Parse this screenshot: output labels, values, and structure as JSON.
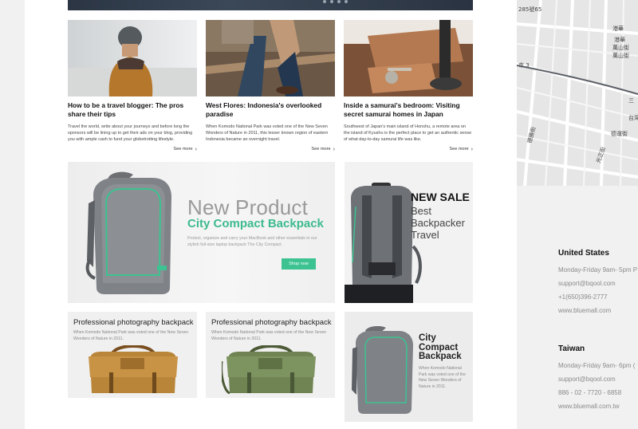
{
  "blog": [
    {
      "title": "How to be a travel blogger: The pros share their tips",
      "text": "Travel the world, write about your journeys and before long the sponsors will be lining up to get their ads on your blog, providing you with ample cash to fund your globetrotting lifestyle.",
      "see_more": "See more"
    },
    {
      "title": "West Flores: Indonesia's overlooked paradise",
      "text": "When Komodo National Park was voted one of the New Seven Wonders of Nature in 2011, this lesser known region of eastern Indonesia became an overnight travel.",
      "see_more": "See more"
    },
    {
      "title": "Inside a samurai's bedroom: Visiting secret samurai homes in Japan",
      "text": "Southwest of Japan's main island of Honshu, a remote area on the island of Kyushu is the perfect place to get an authentic sense of what day-to-day samurai life was like.",
      "see_more": "See more"
    }
  ],
  "banner_main": {
    "title": "New Product",
    "subtitle": "City Compact Backpack",
    "description": "Protect, organize and carry your MacBook and other essentials in our stylish full-size laptop backpack The City Compact.",
    "button": "Shop now"
  },
  "banner_sale": {
    "title": "NEW SALE",
    "subtitle": "Best Backpacker Travel"
  },
  "products": [
    {
      "title": "Professional photography backpack",
      "description": "When Komodo National Park was voted one of the New Seven Wonders of Nature in 2011."
    },
    {
      "title": "Professional photography backpack",
      "description": "When Komodo National Park was voted one of the New Seven Wonders of Nature in 2011."
    }
  ],
  "banner_city": {
    "title": "City Compact Backpack",
    "description": "When Komodo National Park was voted one of the New Seven Wonders of Nature in 2011."
  },
  "map": {
    "labels": [
      "285號65",
      "港華",
      "港華",
      "萬山街",
      "萬山街",
      "市 3",
      "德運街",
      "光正街",
      "台灣",
      "三",
      "德勝街"
    ]
  },
  "contacts": [
    {
      "region": "United States",
      "hours": "Monday-Friday 9am- 5pm P",
      "email": "support@bqool.com",
      "phone": "+1(650)396-2777",
      "web": "www.bluemall.com"
    },
    {
      "region": "Taiwan",
      "hours": "Monday-Friday 9am- 6pm (",
      "email": "support@bqool.com",
      "phone": "886 - 02 - 7720 - 6858",
      "web": "www.bluemall.com.tw"
    }
  ],
  "colors": {
    "accent": "#3cc391",
    "accent_text": "#3dbb8e",
    "page_bg": "#f1f1f2"
  }
}
